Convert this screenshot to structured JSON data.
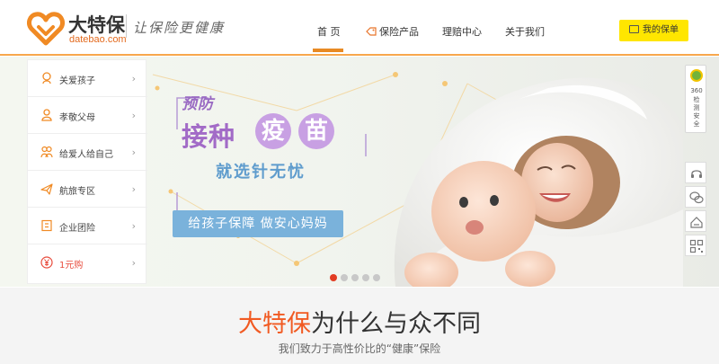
{
  "header": {
    "logo_name": "大特保",
    "logo_domain": "datebao.com",
    "slogan": "让保险更健康",
    "nav": [
      {
        "label": "首 页",
        "active": true
      },
      {
        "label": "保险产品",
        "active": false,
        "icon": "tag-icon"
      },
      {
        "label": "理赔中心",
        "active": false
      },
      {
        "label": "关于我们",
        "active": false
      }
    ],
    "my_policy_label": "我的保单",
    "accent_color": "#f7a74c",
    "button_color": "#ffe600"
  },
  "side_menu": {
    "items": [
      {
        "label": "关爱孩子",
        "icon": "baby-icon"
      },
      {
        "label": "孝敬父母",
        "icon": "elder-icon"
      },
      {
        "label": "给爱人给自己",
        "icon": "couple-icon"
      },
      {
        "label": "航旅专区",
        "icon": "plane-icon"
      },
      {
        "label": "企业团险",
        "icon": "building-icon"
      },
      {
        "label": "1元购",
        "icon": "yuan-icon",
        "highlight": true
      }
    ]
  },
  "banner": {
    "line1": "预防",
    "line2_pre": "接种",
    "line2_c1": "疫",
    "line2_c2": "苗",
    "line3": "就选针无忧",
    "ribbon": "给孩子保障 做安心妈妈",
    "slides": 5,
    "active_slide": 1
  },
  "right_bar": {
    "badge_lines": [
      "360",
      "检",
      "测",
      "安",
      "全"
    ],
    "tools": [
      "headset-icon",
      "wechat-icon",
      "share-icon",
      "qrcode-icon"
    ]
  },
  "bottom": {
    "title_brand": "大特保",
    "title_rest": "为什么与众不同",
    "subtitle": "我们致力于高性价比的“健康”保险"
  }
}
